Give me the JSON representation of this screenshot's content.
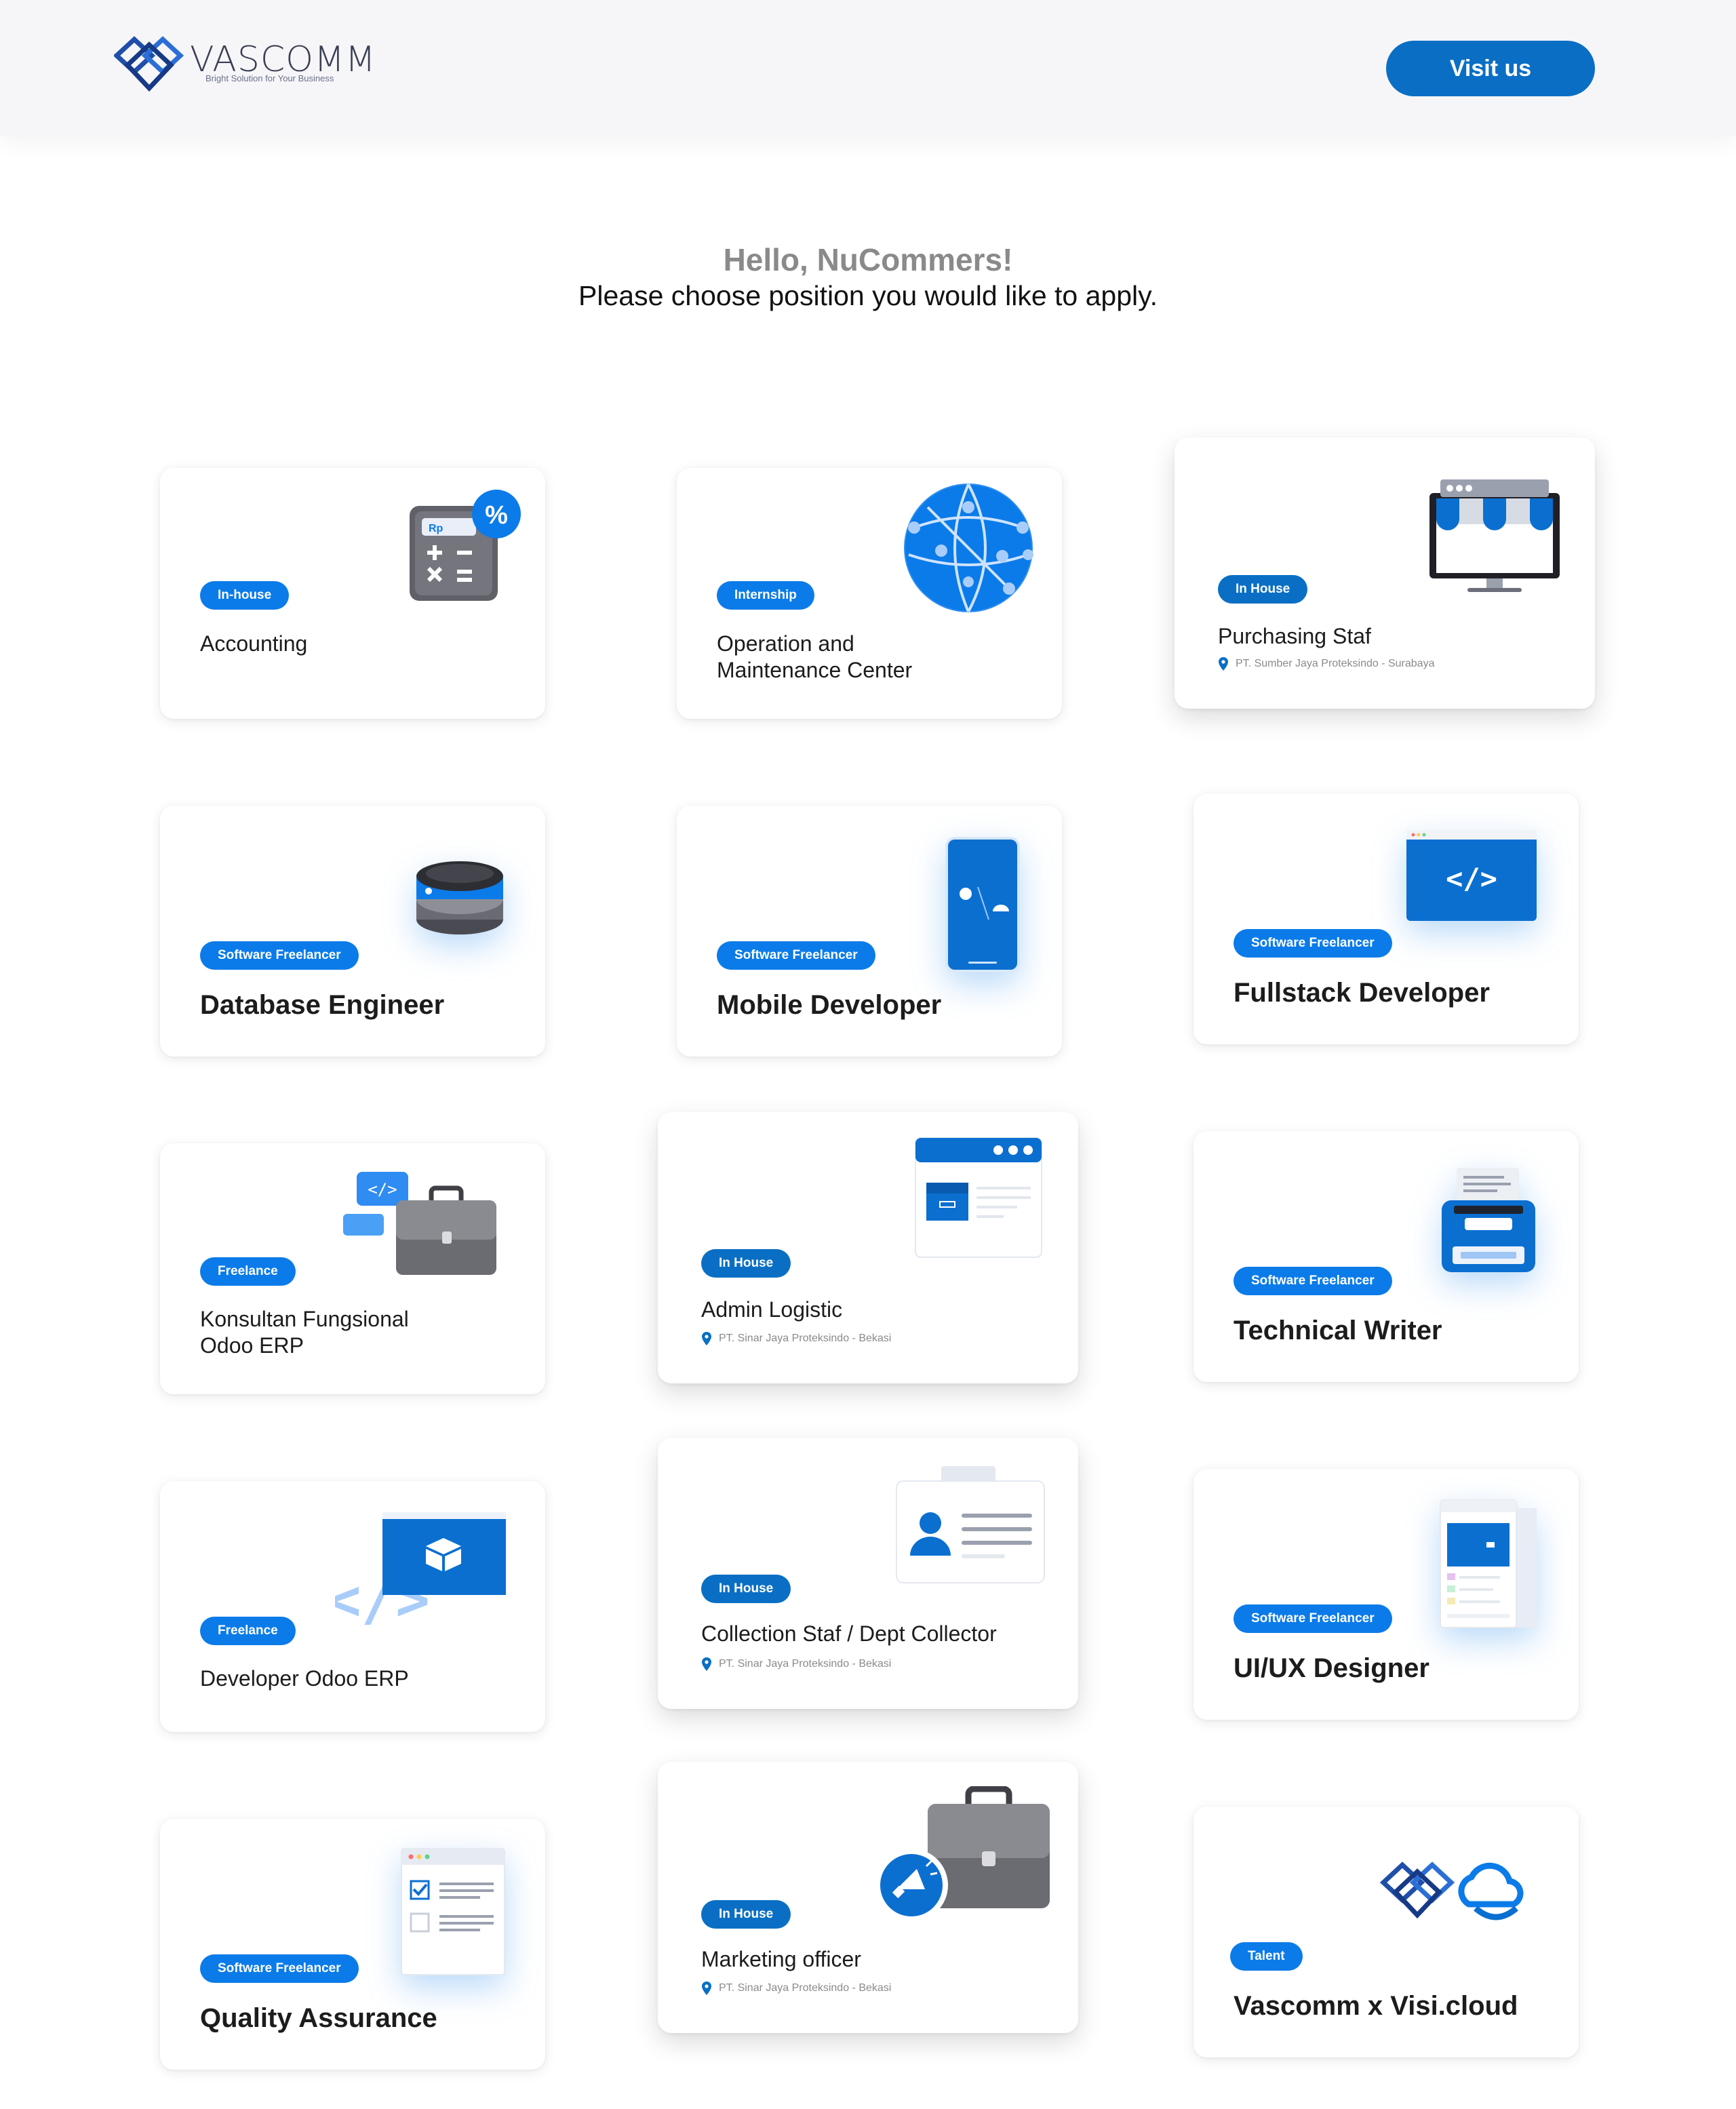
{
  "header": {
    "logo_text": "VASCOMM",
    "logo_tagline": "Bright Solution for Your Business",
    "visit_label": "Visit us"
  },
  "greeting": {
    "hello": "Hello, NuCommers!",
    "subtitle": "Please choose position you would like to apply."
  },
  "colors": {
    "brand_blue": "#0a6fc4",
    "tag_blue": "#0b7be9",
    "header_bg": "#f6f6f8"
  },
  "positions": [
    {
      "tag": "In-house",
      "title_line1": "Accounting",
      "title_line2": "",
      "icon": "calculator-icon"
    },
    {
      "tag": "Internship",
      "title_line1": "Operation and",
      "title_line2": "Maintenance Center",
      "icon": "globe-network-icon"
    },
    {
      "tag": "In House",
      "title_line1": "Purchasing Staf",
      "title_line2": "",
      "location": "PT. Sumber Jaya Proteksindo - Surabaya",
      "icon": "storefront-monitor-icon"
    },
    {
      "tag": "Software Freelancer",
      "title_line1": "Database Engineer",
      "title_line2": "",
      "icon": "database-icon"
    },
    {
      "tag": "Software Freelancer",
      "title_line1": "Mobile Developer",
      "title_line2": "",
      "icon": "smartphone-icon"
    },
    {
      "tag": "Software Freelancer",
      "title_line1": "Fullstack Developer",
      "title_line2": "",
      "icon": "code-window-icon"
    },
    {
      "tag": "Freelance",
      "title_line1": "Konsultan Fungsional",
      "title_line2": "Odoo ERP",
      "icon": "briefcase-code-icon"
    },
    {
      "tag": "In House",
      "title_line1": "Admin Logistic",
      "title_line2": "",
      "location": "PT. Sinar Jaya Proteksindo - Bekasi",
      "icon": "logistic-window-icon"
    },
    {
      "tag": "Software Freelancer",
      "title_line1": "Technical Writer",
      "title_line2": "",
      "icon": "typewriter-icon"
    },
    {
      "tag": "Freelance",
      "title_line1": "Developer Odoo ERP",
      "title_line2": "",
      "icon": "odoo-box-code-icon"
    },
    {
      "tag": "In House",
      "title_line1": "Collection Staf / Dept Collector",
      "title_line2": "",
      "location": "PT. Sinar Jaya Proteksindo - Bekasi",
      "icon": "id-card-icon"
    },
    {
      "tag": "Software Freelancer",
      "title_line1": "UI/UX Designer",
      "title_line2": "",
      "icon": "ui-mockup-icon"
    },
    {
      "tag": "Software Freelancer",
      "title_line1": "Quality Assurance",
      "title_line2": "",
      "icon": "checklist-icon"
    },
    {
      "tag": "In House",
      "title_line1": "Marketing officer",
      "title_line2": "",
      "location": "PT. Sinar Jaya Proteksindo - Bekasi",
      "icon": "megaphone-briefcase-icon"
    },
    {
      "tag": "Talent",
      "title_line1": "Vascomm x Visi.cloud",
      "title_line2": "",
      "icon": "vascomm-visicloud-logo-icon"
    }
  ]
}
